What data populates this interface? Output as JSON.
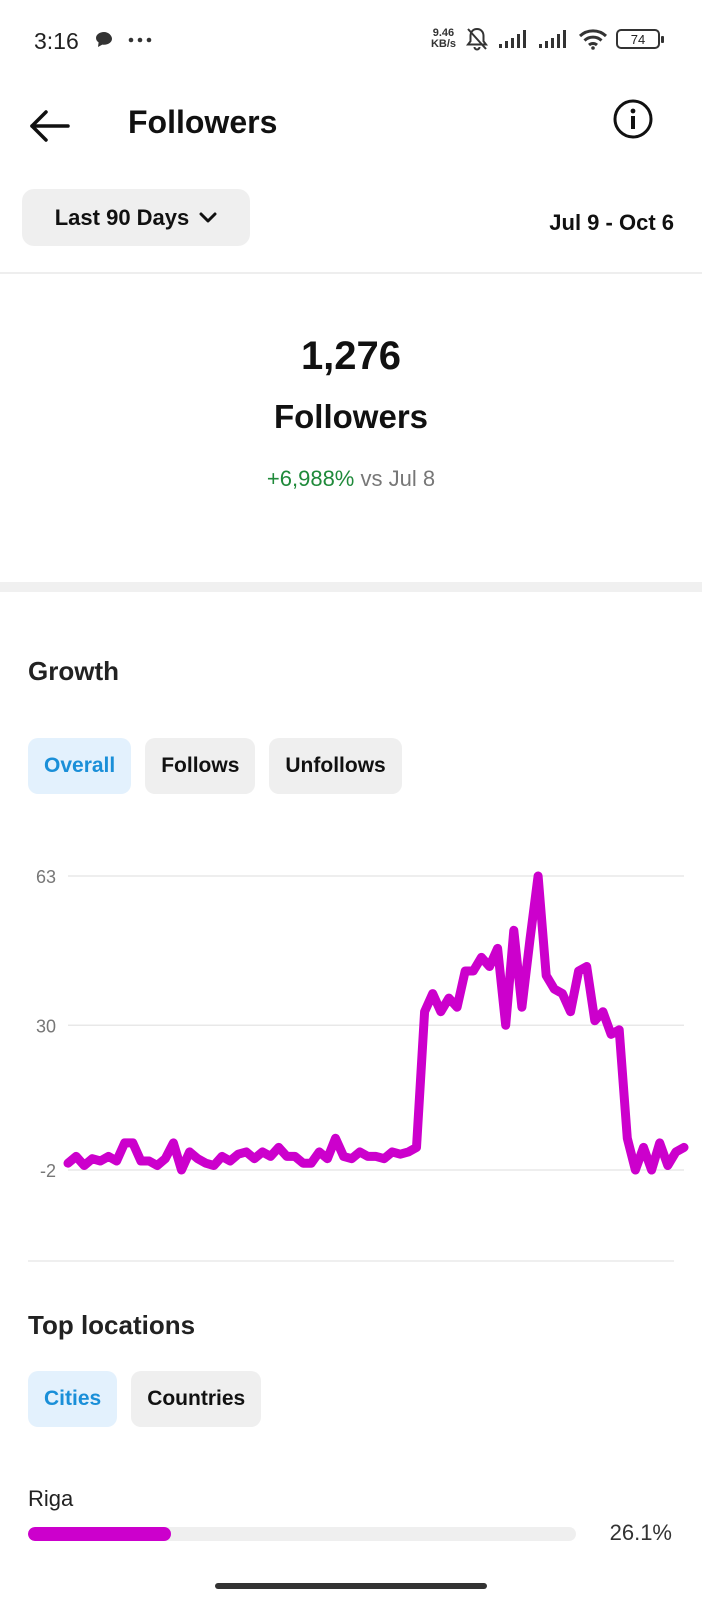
{
  "status_bar": {
    "time": "3:16",
    "net_speed_value": "9.46",
    "net_speed_unit": "KB/s",
    "battery": "74",
    "icons": [
      "chat-bubble-icon",
      "more-dots-icon",
      "mute-bell-icon",
      "signal-icon",
      "signal-icon",
      "wifi-icon",
      "battery-icon"
    ]
  },
  "header": {
    "title": "Followers",
    "back_icon": "arrow-left-icon",
    "info_icon": "info-icon"
  },
  "range": {
    "label": "Last 90 Days",
    "dates": "Jul 9 - Oct 6"
  },
  "summary": {
    "count": "1,276",
    "label": "Followers",
    "change_pct": "+6,988%",
    "change_suffix": "vs Jul 8"
  },
  "growth": {
    "title": "Growth",
    "tabs": [
      {
        "label": "Overall",
        "active": true
      },
      {
        "label": "Follows",
        "active": false
      },
      {
        "label": "Unfollows",
        "active": false
      }
    ]
  },
  "chart_data": {
    "type": "line",
    "ylabels": [
      "63",
      "30",
      "-2"
    ],
    "ylim": [
      -2,
      63
    ],
    "grid": true,
    "color": "#cc00cc",
    "series": [
      {
        "values": [
          -0.5,
          1,
          -1,
          0.5,
          0,
          1,
          0,
          4,
          4,
          0,
          0,
          -1,
          0.5,
          4,
          -2,
          2,
          0.5,
          -0.5,
          -1,
          1,
          0,
          1.5,
          2,
          0.5,
          2,
          1,
          3,
          1,
          1,
          -0.5,
          -0.5,
          2,
          0.5,
          5,
          1,
          0.5,
          2,
          1,
          1,
          0.5,
          2,
          1.5,
          2,
          3,
          33,
          37,
          33,
          36,
          34,
          42,
          42,
          45,
          43,
          47,
          30,
          51,
          34,
          49,
          63,
          41,
          38,
          37,
          33,
          42,
          43,
          31,
          33,
          28,
          29,
          5,
          -2,
          3,
          -2,
          4,
          -1,
          2,
          3
        ]
      }
    ]
  },
  "locations": {
    "title": "Top locations",
    "tabs": [
      {
        "label": "Cities",
        "active": true
      },
      {
        "label": "Countries",
        "active": false
      }
    ],
    "items": [
      {
        "name": "Riga",
        "percent": "26.1%",
        "value": 26.1
      }
    ]
  }
}
